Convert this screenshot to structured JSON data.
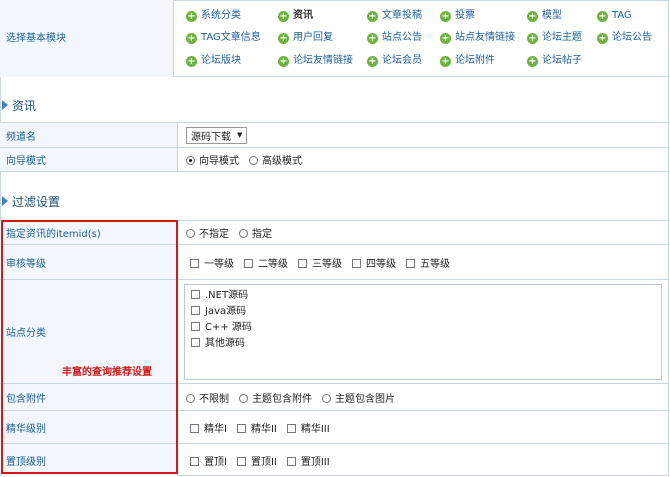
{
  "modules": {
    "label": "选择基本模块",
    "items": [
      {
        "label": "系统分类",
        "active": false
      },
      {
        "label": "资讯",
        "active": true
      },
      {
        "label": "文章投稿",
        "active": false
      },
      {
        "label": "投票",
        "active": false
      },
      {
        "label": "模型",
        "active": false
      },
      {
        "label": "TAG",
        "active": false
      },
      {
        "label": "TAG文章信息",
        "active": false
      },
      {
        "label": "用户回复",
        "active": false
      },
      {
        "label": "站点公告",
        "active": false
      },
      {
        "label": "站点友情链接",
        "active": false
      },
      {
        "label": "论坛主题",
        "active": false
      },
      {
        "label": "论坛公告",
        "active": false
      },
      {
        "label": "论坛版块",
        "active": false
      },
      {
        "label": "论坛友情链接",
        "active": false
      },
      {
        "label": "论坛会员",
        "active": false
      },
      {
        "label": "论坛附件",
        "active": false
      },
      {
        "label": "论坛帖子",
        "active": false
      }
    ],
    "icon": "plus-circle-icon"
  },
  "section_news": {
    "title": "资讯",
    "channel": {
      "label": "频道名",
      "value": "源码下载"
    },
    "wizard": {
      "label": "向导模式",
      "options": [
        "向导模式",
        "高级模式"
      ],
      "selected": 0
    }
  },
  "section_filter": {
    "title": "过滤设置",
    "itemid": {
      "label": "指定资讯的itemid(s)",
      "options": [
        "不指定",
        "指定"
      ]
    },
    "grade": {
      "label": "审核等级",
      "options": [
        "一等级",
        "二等级",
        "三等级",
        "四等级",
        "五等级"
      ]
    },
    "category": {
      "label": "站点分类",
      "items": [
        ".NET源码",
        "Java源码",
        "C++ 源码",
        "其他源码"
      ]
    },
    "attachment": {
      "label": "包含附件",
      "options": [
        "不限制",
        "主题包含附件",
        "主题包含图片"
      ]
    },
    "digest": {
      "label": "精华级别",
      "options": [
        "精华I",
        "精华II",
        "精华III"
      ]
    },
    "top": {
      "label": "置顶级别",
      "options": [
        "置顶I",
        "置顶II",
        "置顶III"
      ]
    }
  },
  "annotation": {
    "text": "丰富的查询推荐设置",
    "color": "#d11b1b"
  },
  "colors": {
    "label_bg": "#f1f7fc",
    "border": "#c9d7e3",
    "link": "#1f5e9a",
    "plus": "#6cb33e"
  }
}
